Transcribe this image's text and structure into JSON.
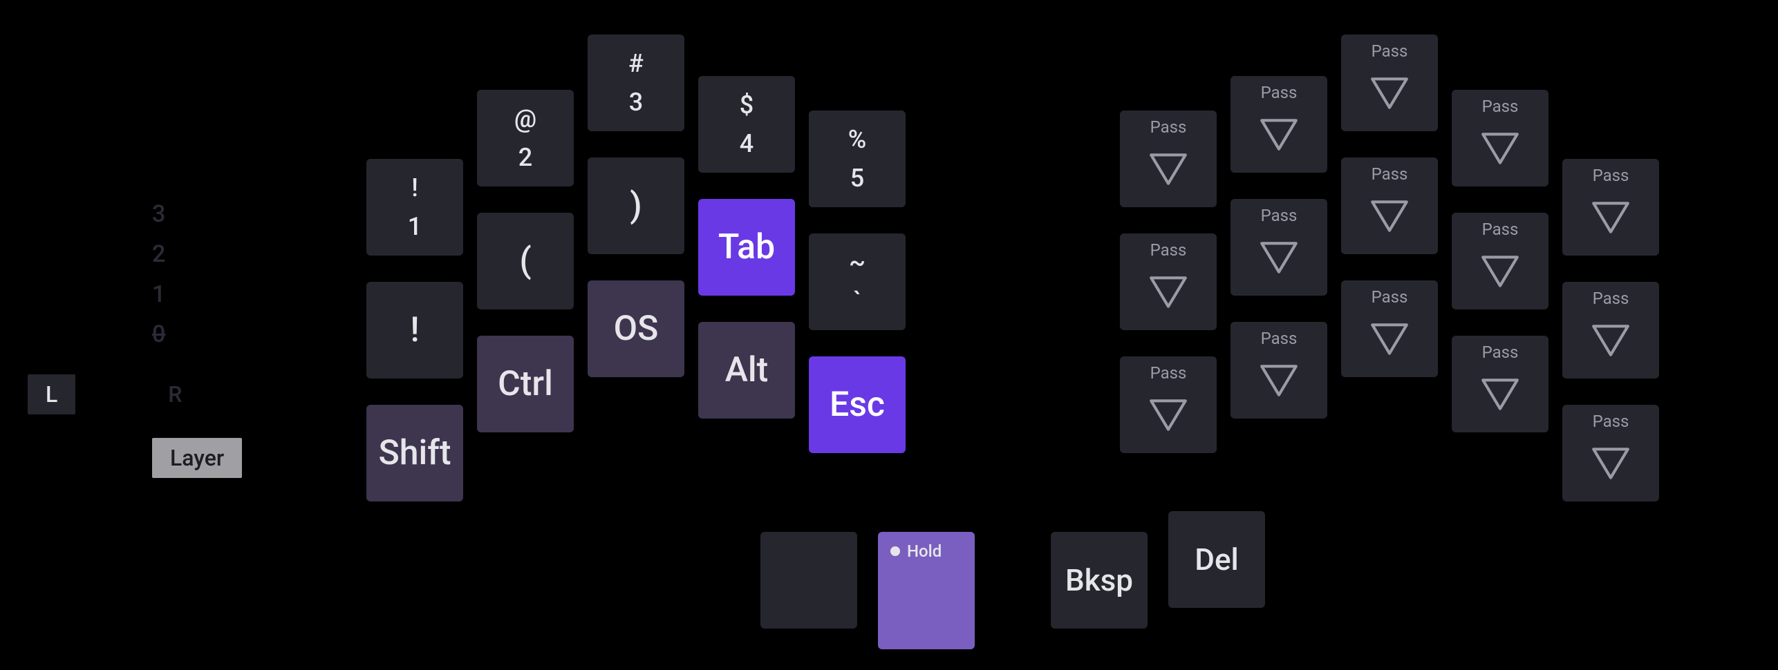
{
  "layer_picker": {
    "numbers": [
      "3",
      "2",
      "1",
      "0"
    ],
    "selected": "0",
    "left_chip": "L",
    "right_label": "R",
    "layer_chip": "Layer"
  },
  "left": {
    "col0": {
      "r0": {
        "top": "!",
        "bot": "1"
      },
      "r1": {
        "big": "!"
      },
      "r2": {
        "big": "Shift",
        "mod": true
      }
    },
    "col1": {
      "r0": {
        "top": "@",
        "bot": "2"
      },
      "r1": {
        "big": "("
      },
      "r2": {
        "big": "Ctrl",
        "mod": true
      }
    },
    "col2": {
      "r0": {
        "top": "#",
        "bot": "3"
      },
      "r1": {
        "big": ")"
      },
      "r2": {
        "big": "OS",
        "mod": true
      }
    },
    "col3": {
      "r0": {
        "top": "$",
        "bot": "4"
      },
      "r1": {
        "big": "Tab",
        "accent": true
      },
      "r2": {
        "big": "Alt",
        "mod": true
      }
    },
    "col4": {
      "r0": {
        "top": "%",
        "bot": "5"
      },
      "r1": {
        "top": "~",
        "bot": "`"
      },
      "r2": {
        "big": "Esc",
        "accent": true
      }
    }
  },
  "right": {
    "pass_label": "Pass"
  },
  "thumbs": {
    "t0": {
      "blank": true
    },
    "t1": {
      "hold_label": "Hold"
    },
    "t2": {
      "big": "Bksp"
    },
    "t3": {
      "big": "Del"
    }
  }
}
